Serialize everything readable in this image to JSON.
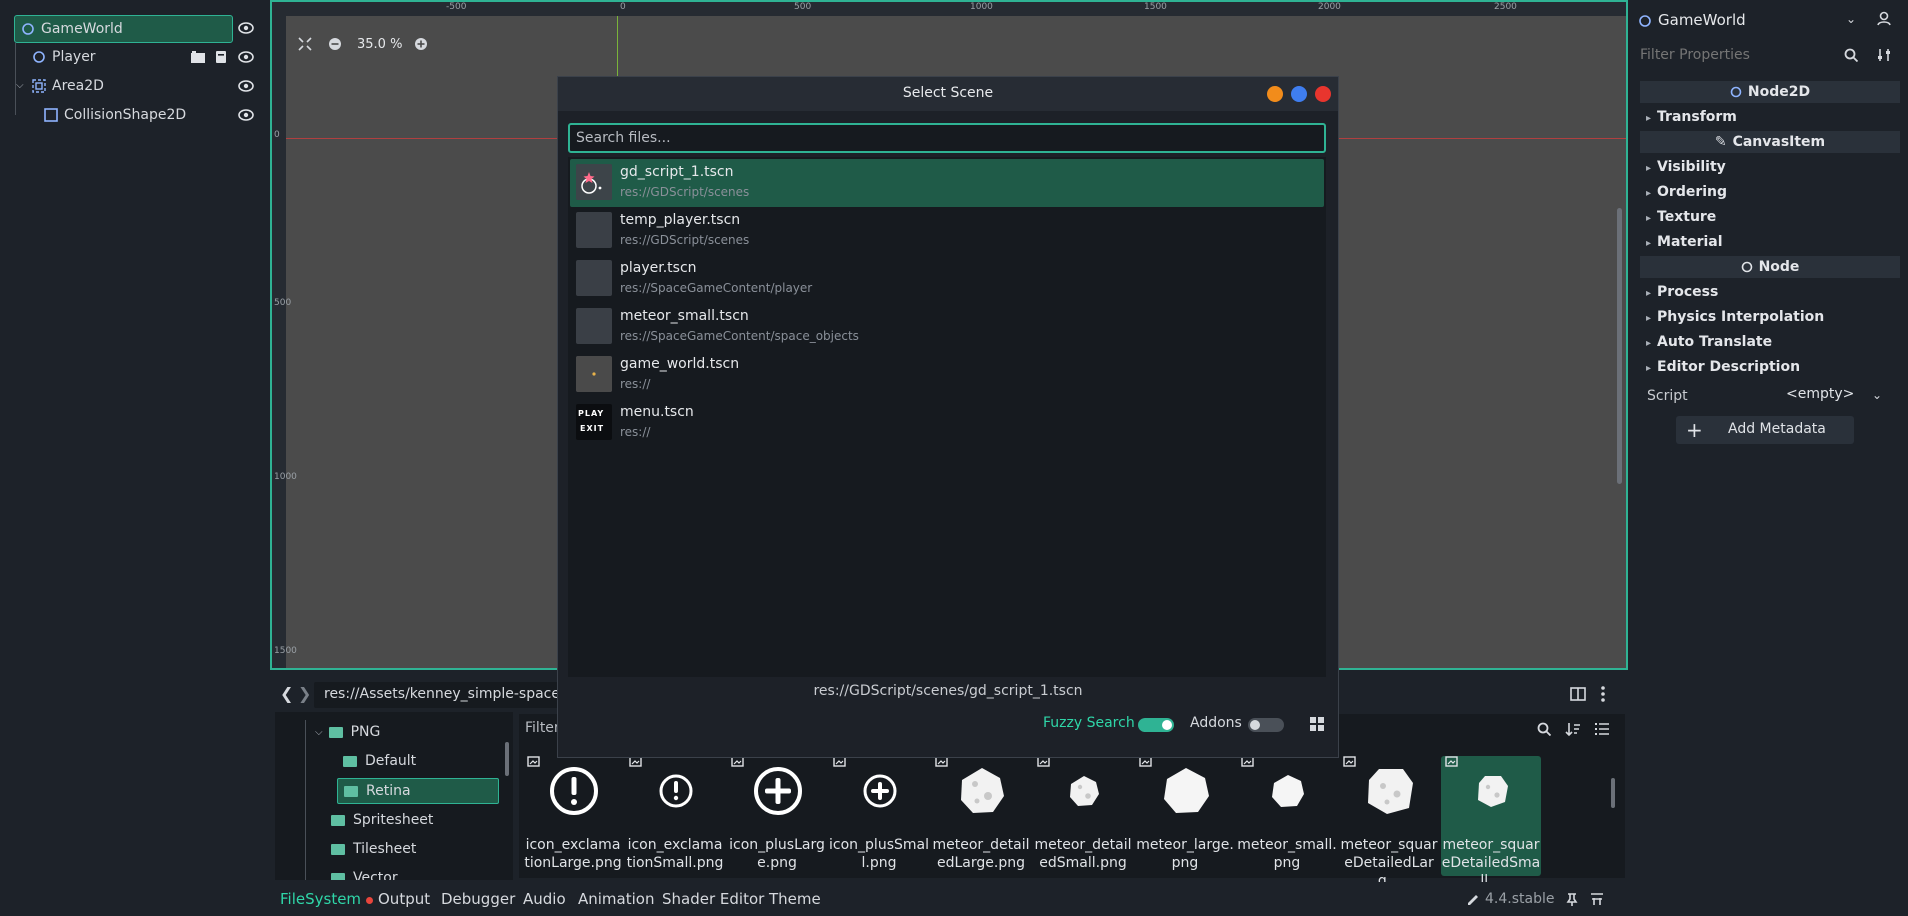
{
  "scene_tree": {
    "nodes": [
      {
        "label": "GameWorld"
      },
      {
        "label": "Player"
      },
      {
        "label": "Area2D"
      },
      {
        "label": "CollisionShape2D"
      }
    ]
  },
  "viewport": {
    "zoom_label": "35.0 %",
    "ruler_top": [
      "-500",
      "0",
      "500",
      "1000",
      "1500",
      "2000",
      "2500"
    ],
    "ruler_left": [
      "0",
      "500",
      "1000",
      "1500"
    ]
  },
  "dialog": {
    "title": "Select Scene",
    "search_placeholder": "Search files...",
    "results": [
      {
        "name": "gd_script_1.tscn",
        "path": "res://GDScript/scenes"
      },
      {
        "name": "temp_player.tscn",
        "path": "res://GDScript/scenes"
      },
      {
        "name": "player.tscn",
        "path": "res://SpaceGameContent/player"
      },
      {
        "name": "meteor_small.tscn",
        "path": "res://SpaceGameContent/space_objects"
      },
      {
        "name": "game_world.tscn",
        "path": "res://"
      },
      {
        "name": "menu.tscn",
        "path": "res://"
      }
    ],
    "menu_thumb_lines": [
      "PLAY",
      "EXIT"
    ],
    "selected_path": "res://GDScript/scenes/gd_script_1.tscn",
    "fuzzy_label": "Fuzzy Search",
    "fuzzy_on": true,
    "addons_label": "Addons",
    "addons_on": false
  },
  "inspector": {
    "node_name": "GameWorld",
    "filter_placeholder": "Filter Properties",
    "node2d_header": "Node2D",
    "canvasitem_header": "CanvasItem",
    "node_header": "Node",
    "sections_node2d": [
      "Transform"
    ],
    "sections_canvas": [
      "Visibility",
      "Ordering",
      "Texture",
      "Material"
    ],
    "sections_node": [
      "Process",
      "Physics Interpolation",
      "Auto Translate",
      "Editor Description"
    ],
    "script_label": "Script",
    "script_value": "<empty>",
    "add_metadata": "Add Metadata"
  },
  "filesystem": {
    "path": "res://Assets/kenney_simple-space/P",
    "filter_placeholder": "Filter",
    "tree": [
      {
        "label": "PNG"
      },
      {
        "label": "Default"
      },
      {
        "label": "Retina"
      },
      {
        "label": "Spritesheet"
      },
      {
        "label": "Tilesheet"
      },
      {
        "label": "Vector"
      }
    ],
    "files": [
      {
        "label": "icon_exclamationLarge.png",
        "icon": "exclamation-large-icon"
      },
      {
        "label": "icon_exclamationSmall.png",
        "icon": "exclamation-small-icon"
      },
      {
        "label": "icon_plusLarge.png",
        "icon": "plus-large-icon"
      },
      {
        "label": "icon_plusSmall.png",
        "icon": "plus-small-icon"
      },
      {
        "label": "meteor_detailedLarge.png",
        "icon": "meteor-icon"
      },
      {
        "label": "meteor_detailedSmall.png",
        "icon": "meteor-icon"
      },
      {
        "label": "meteor_large.png",
        "icon": "meteor-icon"
      },
      {
        "label": "meteor_small.png",
        "icon": "meteor-icon"
      },
      {
        "label": "meteor_squareDetailedLarg...",
        "icon": "meteor-icon"
      },
      {
        "label": "meteor_squareDetailedSmall...",
        "icon": "meteor-icon"
      }
    ]
  },
  "bottom_tabs": [
    "FileSystem",
    "Output",
    "Debugger",
    "Audio",
    "Animation",
    "Shader Editor",
    "Theme"
  ],
  "version": "4.4.stable",
  "colors": {
    "accent": "#2fb394",
    "selected_row": "#1f5b48",
    "window_min": "#f28c1b",
    "window_max": "#3f7ef0",
    "window_close": "#e8352e"
  }
}
